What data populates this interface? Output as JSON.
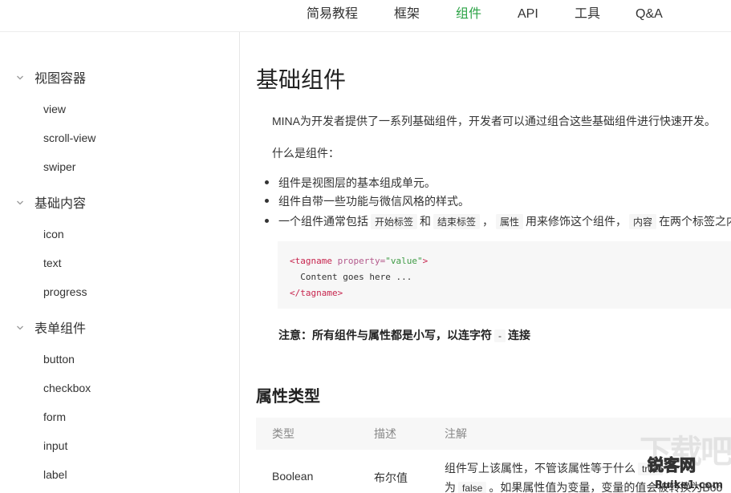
{
  "topnav": {
    "items": [
      {
        "label": "简易教程"
      },
      {
        "label": "框架"
      },
      {
        "label": "组件",
        "active": true
      },
      {
        "label": "API"
      },
      {
        "label": "工具"
      },
      {
        "label": "Q&A"
      }
    ]
  },
  "colors": {
    "accent": "#2ba245",
    "code_tag": "#c7254e",
    "code_value": "#3f9b45"
  },
  "sidebar": {
    "groups": [
      {
        "label": "视图容器",
        "items": [
          "view",
          "scroll-view",
          "swiper"
        ]
      },
      {
        "label": "基础内容",
        "items": [
          "icon",
          "text",
          "progress"
        ]
      },
      {
        "label": "表单组件",
        "items": [
          "button",
          "checkbox",
          "form",
          "input",
          "label"
        ]
      }
    ]
  },
  "content": {
    "title": "基础组件",
    "intro": "MINA为开发者提供了一系列基础组件，开发者可以通过组合这些基础组件进行快速开发。",
    "what_is": "什么是组件：",
    "bullets": {
      "b1": "组件是视图层的基本组成单元。",
      "b2": "组件自带一些功能与微信风格的样式。",
      "b3_a": "一个组件通常包括",
      "b3_code1": "开始标签",
      "b3_b": "和",
      "b3_code2": "结束标签",
      "b3_c": "，",
      "b3_code3": "属性",
      "b3_d": "用来修饰这个组件，",
      "b3_code4": "内容",
      "b3_e": "在两个标签之内"
    },
    "code": {
      "open_tag_start": "<tagname",
      "attr_name": "property=",
      "attr_value": "\"value\"",
      "open_tag_end": ">",
      "body": "  Content goes here ...",
      "close_tag": "</tagname>"
    },
    "note": {
      "text": "注意：所有组件与属性都是小写，以连字符",
      "code": "-",
      "suffix": "连接"
    },
    "section_title": "属性类型",
    "table": {
      "headers": [
        "类型",
        "描述",
        "注解"
      ],
      "row": {
        "type": "Boolean",
        "desc": "布尔值",
        "note_line1_a": "组件写上该属性，不管该属性等于什么",
        "note_line1_code": "true",
        "note_line1_b": "，",
        "note_line2_a": "为",
        "note_line2_code": "false",
        "note_line2_b": "。如果属性值为变量，变量的值会被转换为Boo"
      }
    }
  },
  "watermark": {
    "logo": "锐客网",
    "bg": "下载吧",
    "domain": "Ruike1.com"
  }
}
